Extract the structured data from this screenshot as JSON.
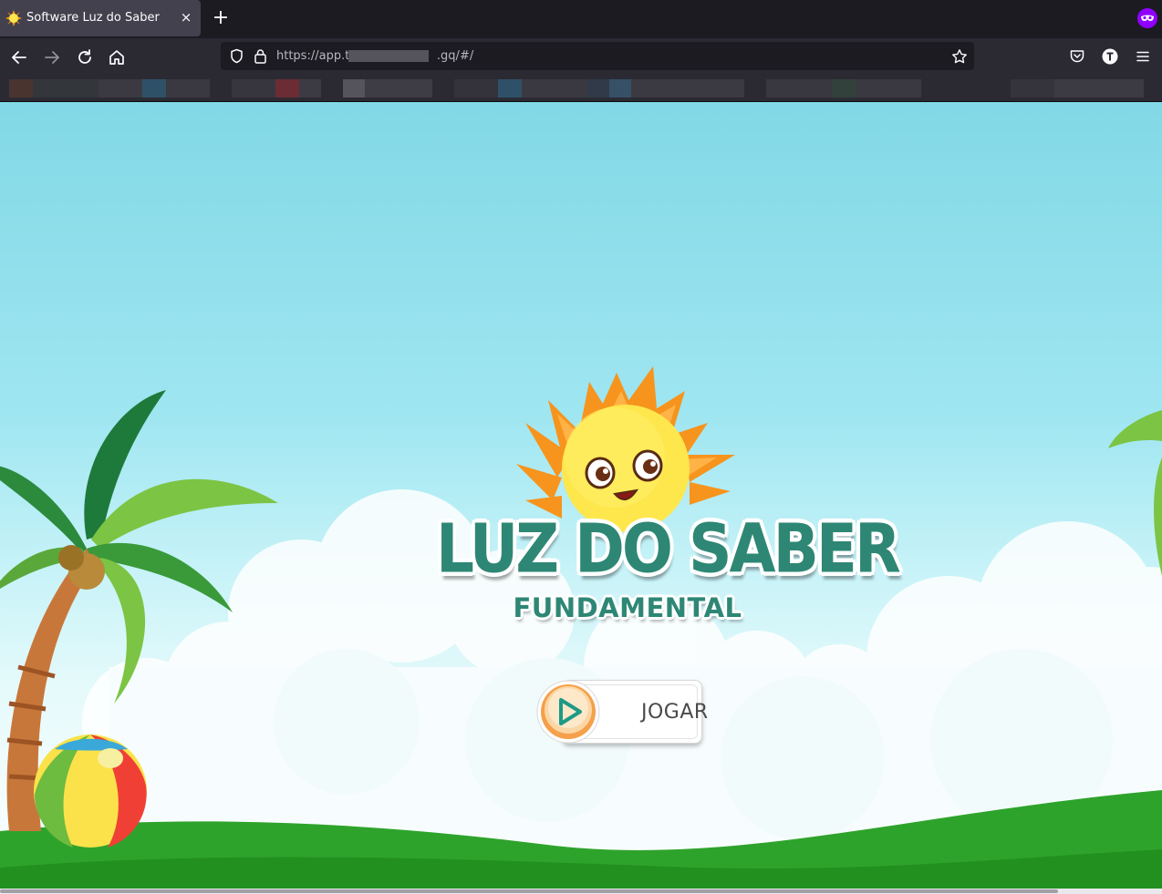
{
  "browser": {
    "tab": {
      "title": "Software Luz do Saber",
      "close_label": "×"
    },
    "new_tab_label": "+",
    "url": {
      "prefix": "https://app.tl",
      "suffix": ".gq/#/"
    }
  },
  "page": {
    "logo_title": "LUZ DO SABER",
    "logo_subtitle": "FUNDAMENTAL",
    "play_button_label": "JOGAR"
  },
  "colors": {
    "logo_green": "#2e8775",
    "sky_top": "#82d8e6",
    "grass": "#2ea32b",
    "sun_orange": "#f7941d",
    "sun_yellow": "#fde74c"
  },
  "icons": [
    "sun-favicon-icon",
    "close-icon",
    "plus-icon",
    "private-browsing-icon",
    "back-icon",
    "forward-icon",
    "reload-icon",
    "home-icon",
    "shield-icon",
    "lock-icon",
    "star-icon",
    "pocket-icon",
    "account-icon",
    "menu-icon",
    "play-icon"
  ]
}
